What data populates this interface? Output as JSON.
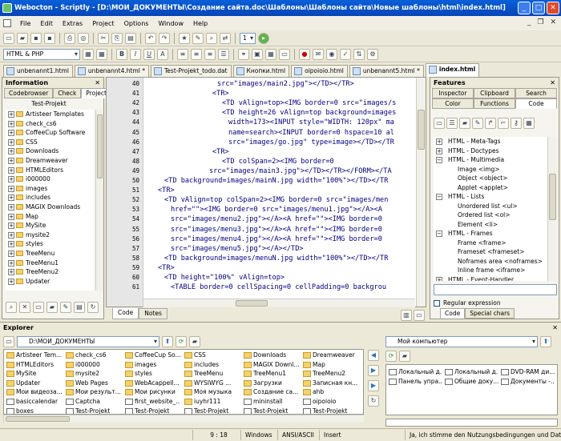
{
  "window": {
    "title": "Webocton - Scriptly - [D:\\МОИ_ДОКУМЕНТЫ\\Создание сайта.doc\\Шаблоны\\Шаблоны сайта\\Новые шаблоны\\html\\index.html]"
  },
  "menu": [
    "File",
    "Edit",
    "Extras",
    "Project",
    "Options",
    "Window",
    "Help"
  ],
  "toolbar": {
    "step_value": "1",
    "language": "HTML & PHP"
  },
  "tabs": [
    {
      "label": "unbenannt1.html",
      "active": false
    },
    {
      "label": "unbenannt4.html *",
      "active": false
    },
    {
      "label": "Test-Projekt_todo.dat",
      "active": false
    },
    {
      "label": "Кнопки.html",
      "active": false
    },
    {
      "label": "oipoioio.html",
      "active": false
    },
    {
      "label": "unbenannt5.html *",
      "active": false
    },
    {
      "label": "index.html",
      "active": true
    }
  ],
  "info_panel": {
    "title": "Information",
    "subtabs": [
      "Codebrowser",
      "Check",
      "Project"
    ],
    "project_name": "Test-Projekt",
    "tree": [
      "Artisteer Templates",
      "check_cs6",
      "CoffeeCup Software",
      "CSS",
      "Downloads",
      "Dreamweaver",
      "HTMLEditors",
      "i000000",
      "images",
      "includes",
      "MAGIX Downloads",
      "Map",
      "MySite",
      "mysite2",
      "styles",
      "TreeMenu",
      "TreeMenu1",
      "TreeMenu2",
      "Updater"
    ]
  },
  "editor": {
    "line_numbers": [
      "40",
      "41",
      "42",
      "43",
      "44",
      "45",
      "46",
      "47",
      "48",
      "49",
      "50",
      "51",
      "52",
      "53",
      "54",
      "55",
      "56",
      "57",
      "58",
      "59",
      "60",
      "61"
    ],
    "lines": [
      "src=\"images/main2.jpg\"></TD></TR>",
      "<TR>",
      "<TD vAlign=top><IMG border=0 src=\"images/s",
      "<TD height=26 vAlign=top background=images",
      "width=173><INPUT style=\"WIDTH: 120px\" ma",
      "name=search><INPUT border=0 hspace=10 al",
      "src=\"images/go.jpg\" type=image></TD></TR",
      "<TR>",
      "<TD colSpan=2><IMG border=0",
      "src=\"images/main3.jpg\"></TD></TR></FORM></TA",
      "<TD background=images/mainN.jpg width=\"100%\"></TD></TR",
      "<TR>",
      "<TD vAlign=top colSpan=2><IMG border=0 src=\"images/men",
      "href=\"\"><IMG border=0 src=\"images/menu1.jpg\"></A><A",
      "src=\"images/menu2.jpg\"></A><A href=\"\"><IMG border=0",
      "src=\"images/menu3.jpg\"></A><A href=\"\"><IMG border=0",
      "src=\"images/menu4.jpg\"></A><A href=\"\"><IMG border=0",
      "src=\"images/menu5.jpg\"></A></TD>",
      "<TD background=images/menuN.jpg width=\"100%\"></TD></TR",
      "<TR>",
      "<TD height=\"100%\" vAlign=top>",
      "<TABLE border=0 cellSpacing=0 cellPadding=0 backgrou"
    ],
    "tabs": [
      "Code",
      "Notes"
    ]
  },
  "features": {
    "title": "Features",
    "subtabs_row1": [
      "Inspector",
      "Clipboard",
      "Search"
    ],
    "subtabs_row2": [
      "Color",
      "Functions",
      "Code"
    ],
    "items": [
      {
        "label": "HTML - Meta-Tags",
        "level": 0
      },
      {
        "label": "HTML - Doctypes",
        "level": 0
      },
      {
        "label": "HTML - Multimedia",
        "level": 0
      },
      {
        "label": "Image <img>",
        "level": 1
      },
      {
        "label": "Object <object>",
        "level": 1
      },
      {
        "label": "Applet <applet>",
        "level": 1
      },
      {
        "label": "HTML - Lists",
        "level": 0
      },
      {
        "label": "Unordered list <ul>",
        "level": 1
      },
      {
        "label": "Ordered list <ol>",
        "level": 1
      },
      {
        "label": "Element <li>",
        "level": 1
      },
      {
        "label": "HTML - Frames",
        "level": 0
      },
      {
        "label": "Frame <frame>",
        "level": 1
      },
      {
        "label": "Frameset <frameset>",
        "level": 1
      },
      {
        "label": "Noframes area <noframes>",
        "level": 1
      },
      {
        "label": "Inline frame <iframe>",
        "level": 1
      },
      {
        "label": "HTML - Event-Handler",
        "level": 0
      }
    ],
    "regular_expression": "Regular expression",
    "bottom_tabs": [
      "Code",
      "Special chars"
    ]
  },
  "explorer": {
    "title": "Explorer",
    "path": "D:\\МОИ_ДОКУМЕНТЫ",
    "grid": [
      [
        "Artisteer Tem...",
        "check_cs6",
        "CoffeeCup So...",
        "CSS",
        "Downloads",
        "Dreamweaver"
      ],
      [
        "HTMLEditors",
        "i000000",
        "images",
        "includes",
        "MAGIX Downl...",
        "Map"
      ],
      [
        "MySite",
        "mysite2",
        "styles",
        "TreeMenu",
        "TreeMenu1",
        "TreeMenu2"
      ],
      [
        "Updater",
        "Web Pages",
        "WebAcappell...",
        "WYSIWYG ...",
        "Загрузки",
        "Записная кн..."
      ],
      [
        "Мои видеоза...",
        "Мои результ...",
        "Мои рисунки",
        "Моя музыка",
        "Создание са...",
        "ahb"
      ],
      [
        "basiccalendar",
        "Captcha",
        "first_website_...",
        "iuyhr111",
        "mininstall",
        "oipoioio"
      ],
      [
        "boxes",
        "Test-Projekt",
        "Test-Projekt",
        "Test-Projekt",
        "Test-Projekt",
        "Test-Projekt"
      ]
    ],
    "right_path": "Мой компьютер",
    "right_items": [
      "Локальный д...",
      "Локальный д...",
      "DVD-RAM ди...",
      "Панель упра...",
      "Общие доку...",
      "Документы -..."
    ]
  },
  "status": {
    "position": "9 : 18",
    "os": "Windows",
    "encoding": "ANSI/ASCII",
    "mode": "Insert",
    "message": "Ja, ich stimme den Nutzungsbedingungen und Date..."
  }
}
